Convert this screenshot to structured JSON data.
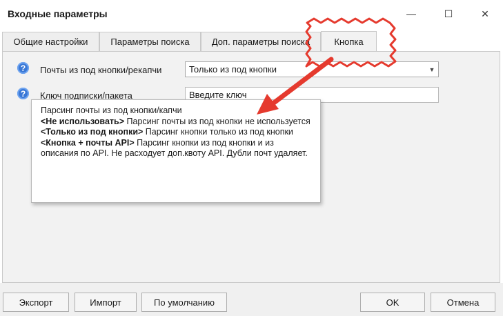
{
  "window": {
    "title": "Входные параметры",
    "minimize_glyph": "—",
    "maximize_glyph": "☐",
    "close_glyph": "✕"
  },
  "tabs": [
    {
      "label": "Общие настройки"
    },
    {
      "label": "Параметры поиска"
    },
    {
      "label": "Доп. параметры поиска"
    },
    {
      "label": "Кнопка",
      "active": true
    }
  ],
  "fields": {
    "mail_source": {
      "label": "Почты из под кнопки/рекапчи",
      "value": "Только из под кнопки"
    },
    "subscription_key": {
      "label": "Ключ подписки/пакета",
      "placeholder": "Введите ключ"
    }
  },
  "help_icon": "?",
  "tooltip": {
    "intro": "Парсинг почты из под кнопки/капчи",
    "opt1_title": "<Не использовать>",
    "opt1_text": " Парсинг почты из под кнопки не используется",
    "opt2_title": "<Только из под кнопки>",
    "opt2_text": " Парсинг кнопки только из под кнопки",
    "opt3_title": "<Кнопка + почты API>",
    "opt3_text": " Парсинг кнопки из под кнопки и из описания по API. Не расходует доп.квоту API. Дубли почт удаляет."
  },
  "footer": {
    "export": "Экспорт",
    "import": "Импорт",
    "defaults": "По умолчанию",
    "ok": "OK",
    "cancel": "Отмена"
  },
  "annotation_color": "#e53a2e"
}
